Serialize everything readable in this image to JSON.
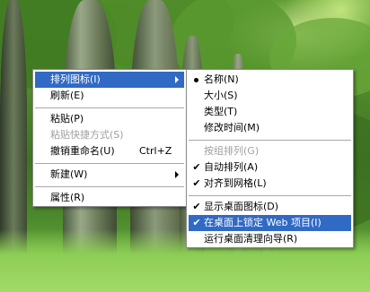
{
  "main_menu": {
    "items": [
      {
        "label": "排列图标(I)",
        "has_submenu": true,
        "selected": true
      },
      {
        "label": "刷新(E)"
      },
      {
        "label": "粘贴(P)"
      },
      {
        "label": "粘贴快捷方式(S)",
        "disabled": true
      },
      {
        "label": "撤销重命名(U)",
        "shortcut": "Ctrl+Z"
      },
      {
        "label": "新建(W)",
        "has_submenu": true
      },
      {
        "label": "属性(R)"
      }
    ]
  },
  "sub_menu": {
    "items": [
      {
        "label": "名称(N)",
        "mark": "bullet"
      },
      {
        "label": "大小(S)"
      },
      {
        "label": "类型(T)"
      },
      {
        "label": "修改时间(M)"
      },
      {
        "label": "按组排列(G)",
        "disabled": true
      },
      {
        "label": "自动排列(A)",
        "mark": "check"
      },
      {
        "label": "对齐到网格(L)",
        "mark": "check"
      },
      {
        "label": "显示桌面图标(D)",
        "mark": "check"
      },
      {
        "label": "在桌面上锁定 Web 项目(I)",
        "mark": "check",
        "selected": true
      },
      {
        "label": "运行桌面清理向导(R)"
      }
    ]
  },
  "colors": {
    "selection": "#316ac5",
    "disabled_text": "#a0a0a0"
  }
}
